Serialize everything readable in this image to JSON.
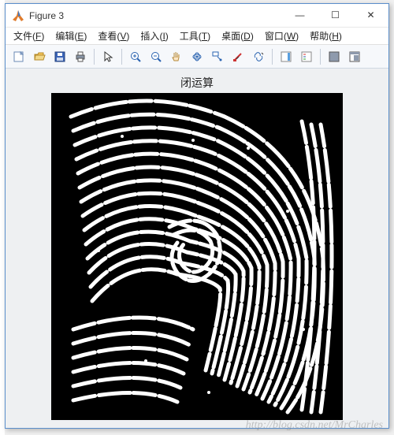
{
  "window": {
    "title": "Figure 3",
    "minimize": "—",
    "maximize": "☐",
    "close": "✕"
  },
  "menubar": {
    "items": [
      {
        "label": "文件",
        "mn": "F"
      },
      {
        "label": "编辑",
        "mn": "E"
      },
      {
        "label": "查看",
        "mn": "V"
      },
      {
        "label": "插入",
        "mn": "I"
      },
      {
        "label": "工具",
        "mn": "T"
      },
      {
        "label": "桌面",
        "mn": "D"
      },
      {
        "label": "窗口",
        "mn": "W"
      },
      {
        "label": "帮助",
        "mn": "H"
      }
    ]
  },
  "toolbar": {
    "groups": [
      [
        "new-figure",
        "open",
        "save",
        "print"
      ],
      [
        "edit-plot"
      ],
      [
        "zoom-in",
        "zoom-out",
        "pan",
        "rotate-3d",
        "data-cursor",
        "brush",
        "link"
      ],
      [
        "insert-colorbar",
        "insert-legend"
      ],
      [
        "hide-tools",
        "dock-figure"
      ]
    ]
  },
  "figure": {
    "title": "闭运算"
  },
  "watermark": "http://blog.csdn.net/MrCharles"
}
